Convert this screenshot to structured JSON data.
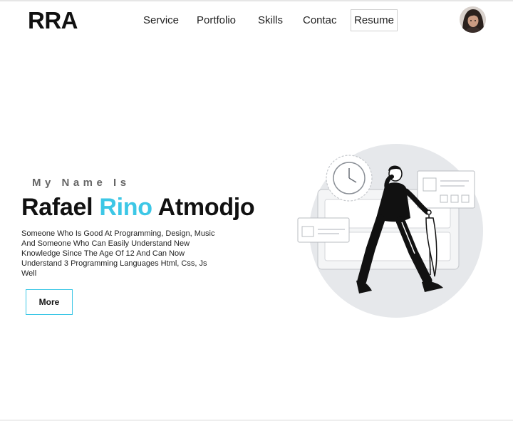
{
  "header": {
    "logo": "RRA",
    "nav": [
      {
        "label": "Service"
      },
      {
        "label": "Portfolio"
      },
      {
        "label": "Skills"
      },
      {
        "label": "Contac"
      }
    ],
    "resume_label": "Resume"
  },
  "hero": {
    "kicker": "My Name Is",
    "title_first": "Rafael",
    "title_accent": "Rino",
    "title_last": "Atmodjo",
    "description": "Someone Who Is Good At Programming, Design, Music And Someone Who Can Easily Understand New Knowledge Since The Age Of 12 And Can Now Understand 3 Programming Languages Html, Css, Js Well",
    "button_label": "More"
  },
  "colors": {
    "accent": "#3dc7e6",
    "text": "#111111",
    "illustration_circle": "#e6e8eb"
  },
  "icons": {
    "avatar": "profile-photo",
    "illustration": "walking-man-with-umbrella"
  }
}
